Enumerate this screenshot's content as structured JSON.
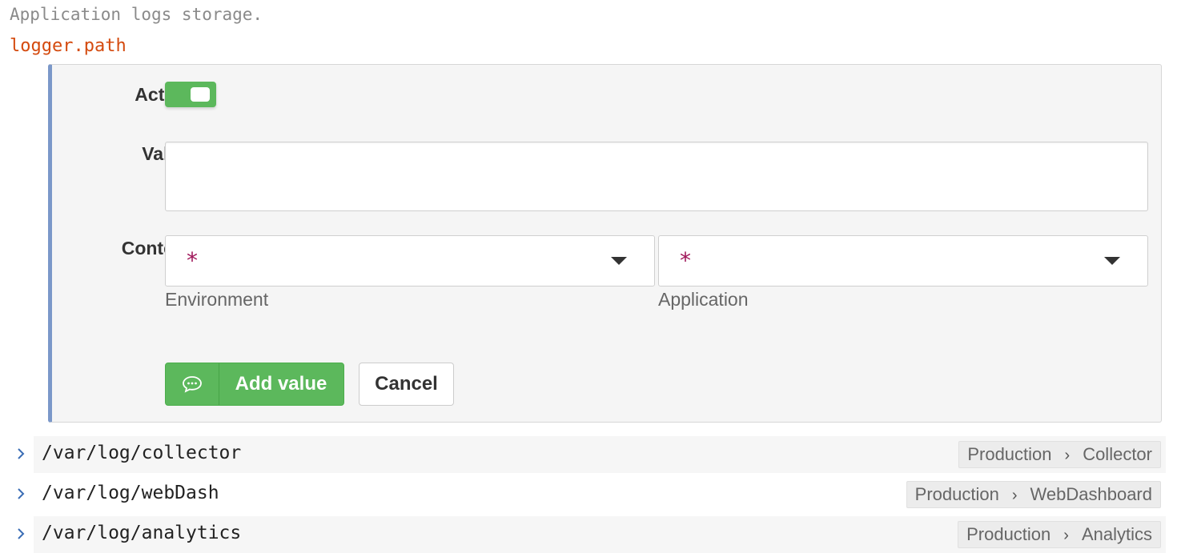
{
  "description": "Application logs storage.",
  "key_name": "logger.path",
  "form": {
    "active_label": "Active:",
    "active_state": true,
    "value_label": "Value:",
    "value_text": "",
    "context_label": "Context:",
    "environment": {
      "selected": "*",
      "caption": "Environment"
    },
    "application": {
      "selected": "*",
      "caption": "Application"
    },
    "add_button_label": "Add value",
    "cancel_button_label": "Cancel",
    "toggle_color": "#5cb85c",
    "accent_border_color": "#7b98c9"
  },
  "values": [
    {
      "path": "/var/log/collector",
      "environment": "Production",
      "application": "Collector"
    },
    {
      "path": "/var/log/webDash",
      "environment": "Production",
      "application": "WebDashboard"
    },
    {
      "path": "/var/log/analytics",
      "environment": "Production",
      "application": "Analytics"
    }
  ],
  "icons": {
    "add_button_icon": "speech-bubble-icon",
    "row_expand_icon": "chevron-right-icon",
    "crumb_separator_icon": "chevron-right-icon",
    "select_icon": "caret-down-icon"
  }
}
